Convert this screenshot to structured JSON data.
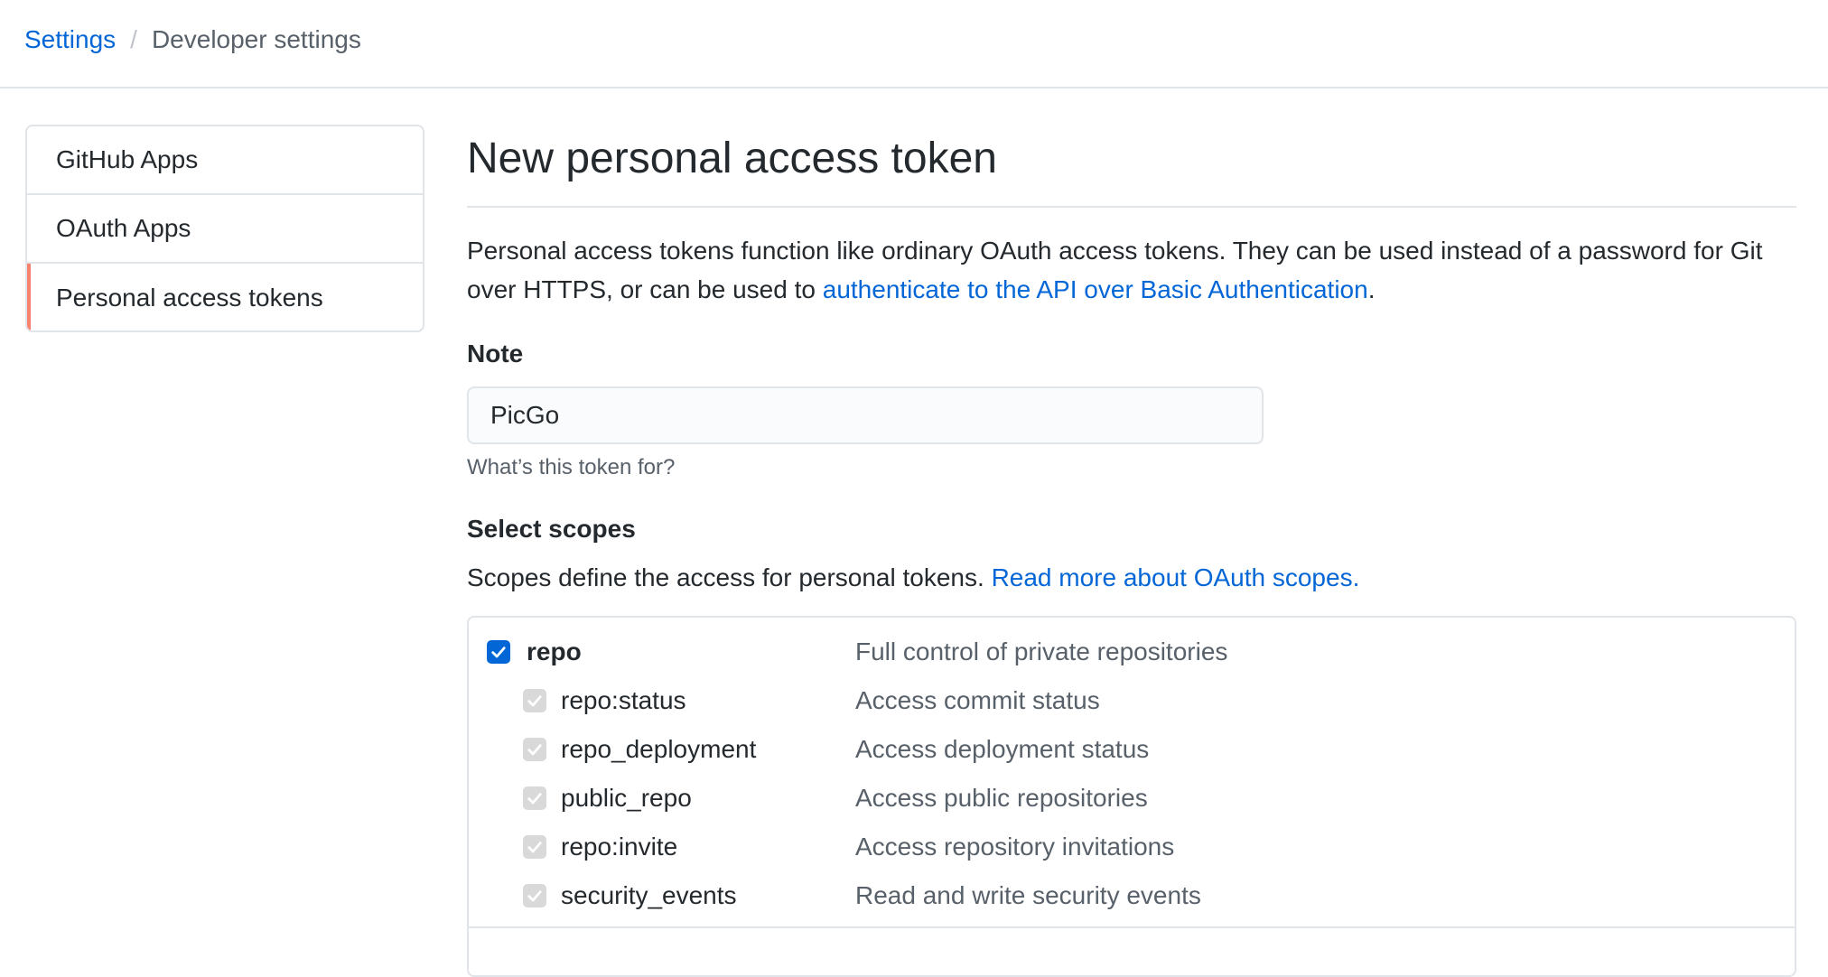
{
  "breadcrumb": {
    "root": "Settings",
    "separator": "/",
    "current": "Developer settings"
  },
  "sidebar": {
    "items": [
      {
        "label": "GitHub Apps"
      },
      {
        "label": "OAuth Apps"
      },
      {
        "label": "Personal access tokens",
        "selected": true
      }
    ]
  },
  "main": {
    "title": "New personal access token",
    "intro": {
      "text_before": "Personal access tokens function like ordinary OAuth access tokens. They can be used instead of a password for Git over HTTPS, or can be used to ",
      "link": "authenticate to the API over Basic Authentication",
      "text_after": "."
    },
    "note": {
      "label": "Note",
      "value": "PicGo",
      "hint": "What’s this token for?"
    },
    "scopes": {
      "label": "Select scopes",
      "desc_before": "Scopes define the access for personal tokens. ",
      "desc_link": "Read more about OAuth scopes.",
      "rows": [
        {
          "name": "repo",
          "desc": "Full control of private repositories",
          "checked": true,
          "parent": true
        },
        {
          "name": "repo:status",
          "desc": "Access commit status",
          "checked": true,
          "parent": false
        },
        {
          "name": "repo_deployment",
          "desc": "Access deployment status",
          "checked": true,
          "parent": false
        },
        {
          "name": "public_repo",
          "desc": "Access public repositories",
          "checked": true,
          "parent": false
        },
        {
          "name": "repo:invite",
          "desc": "Access repository invitations",
          "checked": true,
          "parent": false
        },
        {
          "name": "security_events",
          "desc": "Read and write security events",
          "checked": true,
          "parent": false
        }
      ]
    }
  },
  "colors": {
    "link": "#0366d6",
    "selected_accent": "#f9826c",
    "border": "#e1e4e8",
    "muted_text": "#586069",
    "checkbox_checked": "#0366d6",
    "checkbox_disabled": "#d9d9d9"
  }
}
